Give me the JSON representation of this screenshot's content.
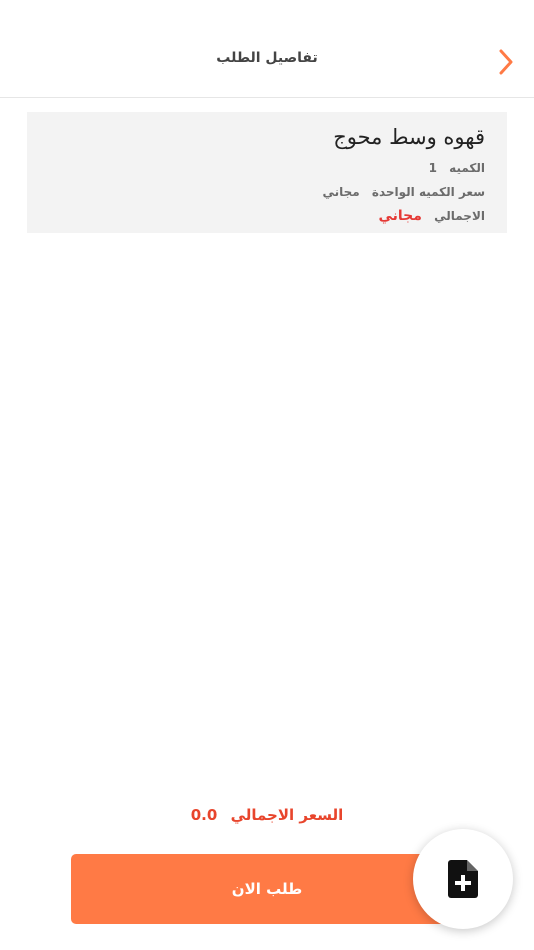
{
  "header": {
    "title": "تفاصيل الطلب",
    "back_icon": "chevron-right-icon",
    "accent_color": "#ff7a45"
  },
  "item": {
    "name": "قهوه وسط محوج",
    "quantity_label": "الكميه",
    "quantity_value": "1",
    "unit_price_label": "سعر الكميه الواحدة",
    "unit_price_value": "مجاني",
    "total_label": "الاجمالي",
    "total_value": "مجاني",
    "total_color": "#e53935"
  },
  "summary": {
    "total_label": "السعر الاجمالي",
    "total_value": "0.0",
    "color": "#e8452c"
  },
  "order_button": {
    "label": "طلب الان",
    "color": "#ff7a45"
  },
  "fab": {
    "icon": "file-add-icon"
  }
}
